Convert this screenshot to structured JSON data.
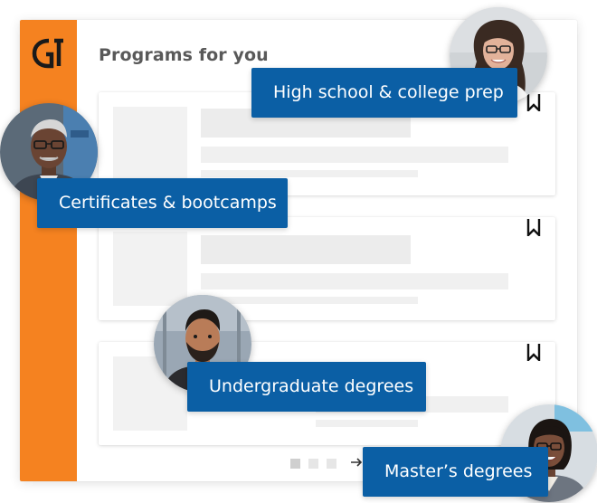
{
  "page": {
    "title": "Programs for you"
  },
  "brand": {
    "accent": "#f58220",
    "pill_color": "#0b5fa5",
    "logo_icon": "g-logo-icon"
  },
  "cards": [
    {
      "bookmark_icon": "bookmark-icon"
    },
    {
      "bookmark_icon": "bookmark-icon"
    },
    {
      "bookmark_icon": "bookmark-icon"
    }
  ],
  "pagination": {
    "pages": 3,
    "next_icon": "arrow-right-icon"
  },
  "categories": [
    {
      "label": "High school & college prep"
    },
    {
      "label": "Certificates & bootcamps"
    },
    {
      "label": "Undergraduate degrees"
    },
    {
      "label": "Master’s degrees"
    }
  ]
}
